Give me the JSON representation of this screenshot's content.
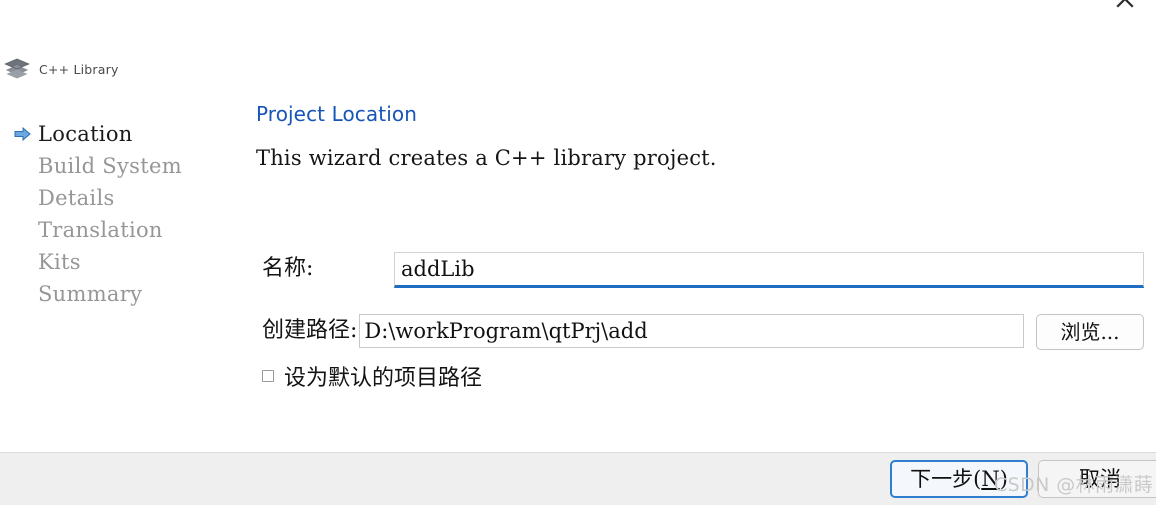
{
  "titlebar": {
    "close_icon": "close-icon"
  },
  "header": {
    "icon": "library-stack-icon",
    "label": "C++ Library"
  },
  "sidebar": {
    "items": [
      {
        "label": "Location",
        "active": true
      },
      {
        "label": "Build System",
        "active": false
      },
      {
        "label": "Details",
        "active": false
      },
      {
        "label": "Translation",
        "active": false
      },
      {
        "label": "Kits",
        "active": false
      },
      {
        "label": "Summary",
        "active": false
      }
    ]
  },
  "content": {
    "title": "Project Location",
    "description": "This wizard creates a C++ library project."
  },
  "form": {
    "name_label": "名称:",
    "name_value": "addLib",
    "path_label": "创建路径:",
    "path_value": "D:\\workProgram\\qtPrj\\add",
    "browse_label": "浏览...",
    "default_path_label": "设为默认的项目路径",
    "default_path_checked": false
  },
  "footer": {
    "next_prefix": "下一步(",
    "next_accel": "N",
    "next_suffix": ")",
    "cancel_label": "取消"
  },
  "watermark": {
    "text": "CSDN @林雨潇蒔"
  },
  "colors": {
    "accent_blue": "#1855b8",
    "focus_blue": "#2f7fd0",
    "input_underline": "#1e6fc4",
    "inactive_step": "#969696",
    "footer_bg": "#efefef"
  }
}
